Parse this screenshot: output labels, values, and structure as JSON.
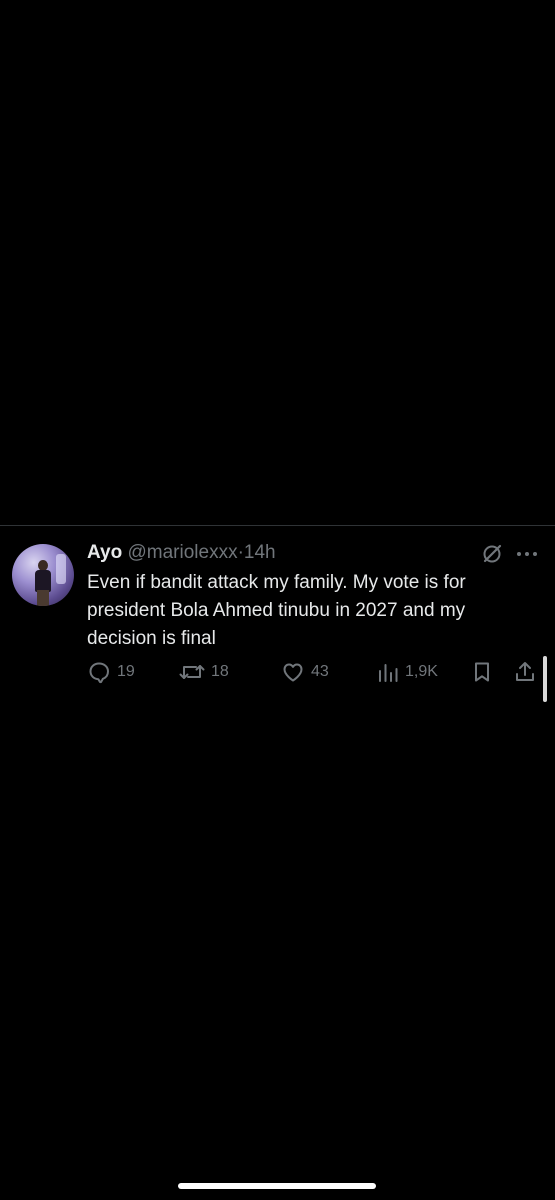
{
  "tweet": {
    "name": "Ayo",
    "handle": "@mariolexxx",
    "separator": "·",
    "time": "14h",
    "text": "Even if bandit attack my family. My vote is for president Bola Ahmed tinubu in 2027 and my decision is final",
    "avatar_icon": "profile-photo",
    "grok_icon": "grok-icon",
    "more_icon": "more-options-icon",
    "actions": {
      "replies": "19",
      "retweets": "18",
      "likes": "43",
      "views": "1,9K"
    }
  },
  "colors": {
    "background": "#000000",
    "primary_text": "#e7e9ea",
    "secondary_text": "#71767b",
    "divider": "#2f3336"
  }
}
